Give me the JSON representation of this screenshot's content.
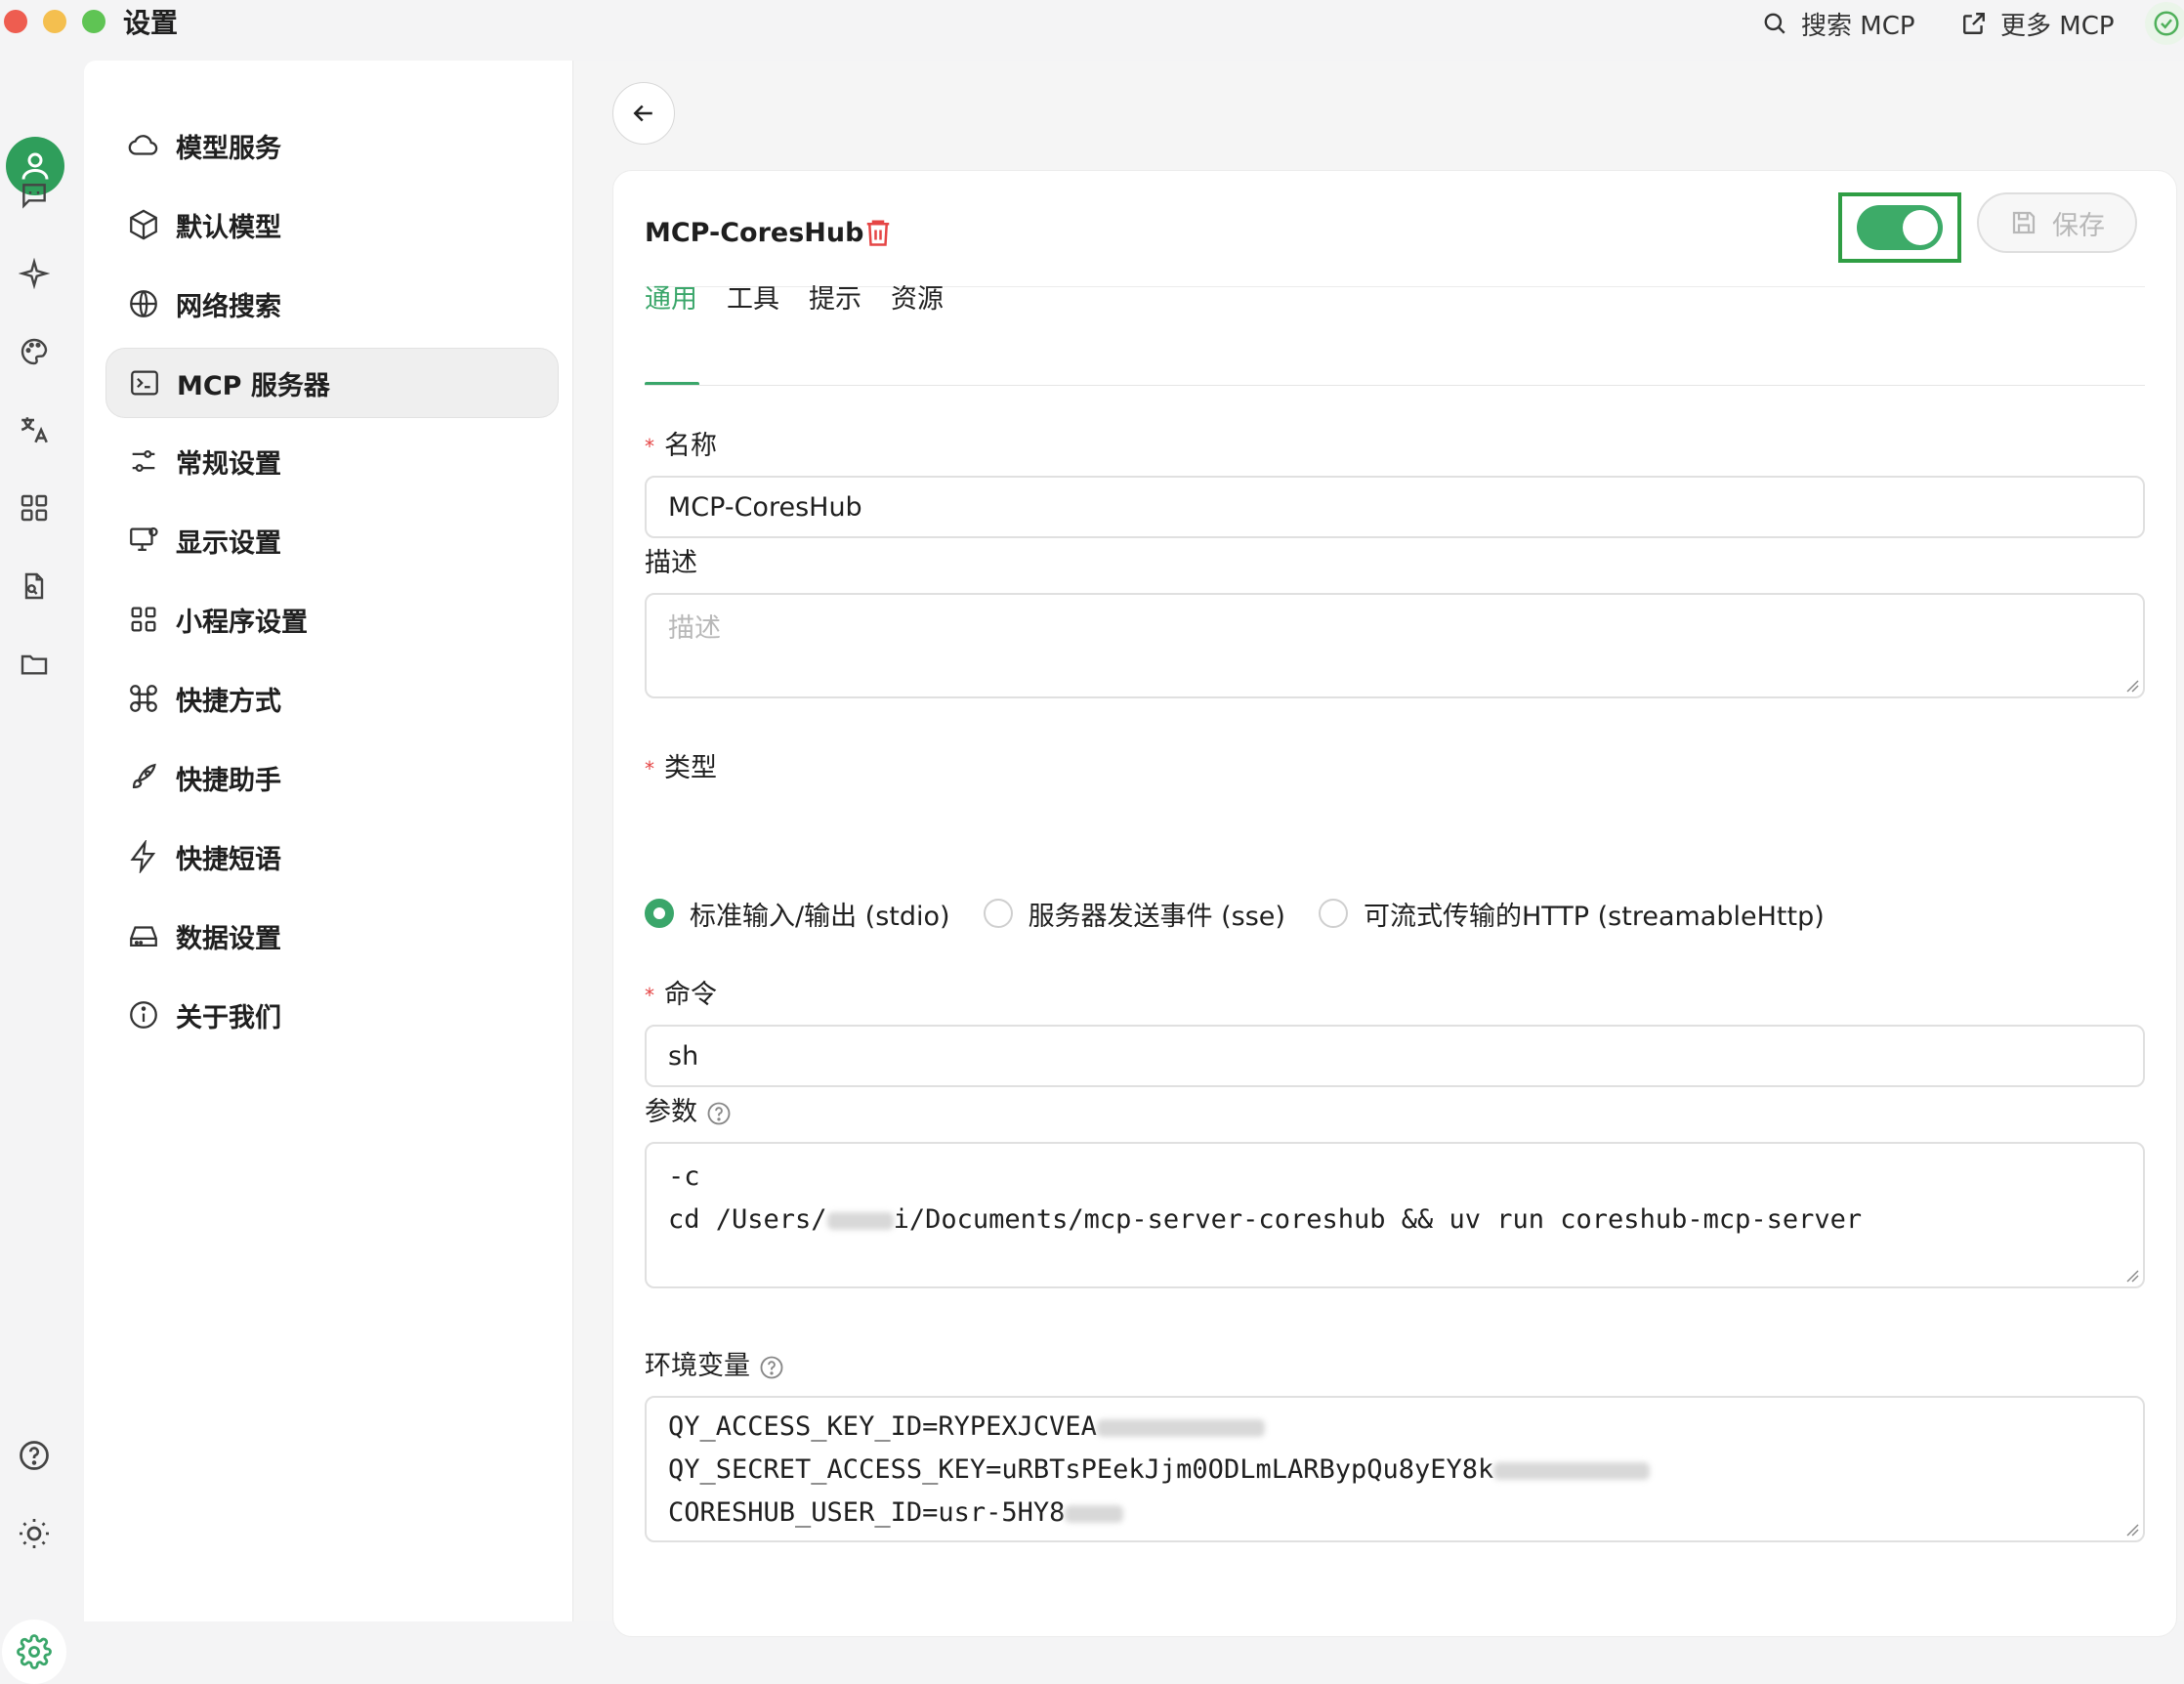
{
  "app": {
    "title": "设置"
  },
  "topbar": {
    "search_mcp": "搜索 MCP",
    "more_mcp": "更多 MCP"
  },
  "colors": {
    "accent": "#3aa66a",
    "danger": "#e54545",
    "highlight_frame": "#2f9e44"
  },
  "iconbar": {
    "icons": [
      "user-avatar",
      "chat-icon",
      "sparkle-icon",
      "palette-icon",
      "translate-icon",
      "apps-icon",
      "file-search-icon",
      "folder-icon",
      "help-icon",
      "theme-icon",
      "settings-icon"
    ]
  },
  "nav": {
    "items": [
      {
        "label": "模型服务",
        "icon": "cloud-icon"
      },
      {
        "label": "默认模型",
        "icon": "cube-icon"
      },
      {
        "label": "网络搜索",
        "icon": "globe-icon"
      },
      {
        "label": "MCP 服务器",
        "icon": "terminal-icon",
        "active": true
      },
      {
        "label": "常规设置",
        "icon": "sliders-icon"
      },
      {
        "label": "显示设置",
        "icon": "monitor-icon"
      },
      {
        "label": "小程序设置",
        "icon": "grid-icon"
      },
      {
        "label": "快捷方式",
        "icon": "command-icon"
      },
      {
        "label": "快捷助手",
        "icon": "rocket-icon"
      },
      {
        "label": "快捷短语",
        "icon": "zap-icon"
      },
      {
        "label": "数据设置",
        "icon": "drive-icon"
      },
      {
        "label": "关于我们",
        "icon": "info-icon"
      }
    ]
  },
  "server": {
    "title": "MCP-CoresHub",
    "enabled": true,
    "save_label": "保存",
    "tabs": [
      "通用",
      "工具",
      "提示",
      "资源"
    ],
    "active_tab": "通用",
    "fields": {
      "name_label": "名称",
      "name_value": "MCP-CoresHub",
      "desc_label": "描述",
      "desc_placeholder": "描述",
      "type_label": "类型",
      "type_options": [
        "标准输入/输出 (stdio)",
        "服务器发送事件 (sse)",
        "可流式传输的HTTP (streamableHttp)"
      ],
      "type_selected": "标准输入/输出 (stdio)",
      "command_label": "命令",
      "command_value": "sh",
      "args_label": "参数",
      "args_lines": [
        "-c",
        "cd /Users/",
        "i/Documents/mcp-server-coreshub && uv run coreshub-mcp-server"
      ],
      "env_label": "环境变量",
      "env_lines": [
        "QY_ACCESS_KEY_ID=RYPEXJCVEA",
        "QY_SECRET_ACCESS_KEY=uRBTsPEekJjm0ODLmLARBypQu8yEY8k",
        "CORESHUB_USER_ID=usr-5HY8"
      ]
    }
  }
}
